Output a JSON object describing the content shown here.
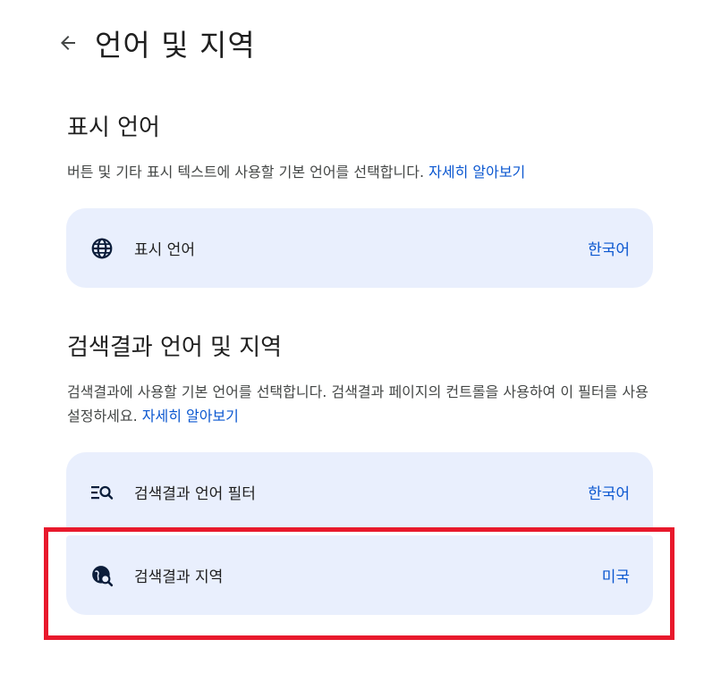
{
  "header": {
    "title": "언어 및 지역",
    "back_icon": "arrow-back-icon"
  },
  "display_language": {
    "title": "표시 언어",
    "description": "버튼 및 기타 표시 텍스트에 사용할 기본 언어를 선택합니다. ",
    "learn_more": "자세히 알아보기",
    "row": {
      "icon": "globe-icon",
      "label": "표시 언어",
      "value": "한국어"
    }
  },
  "search_results": {
    "title": "검색결과 언어 및 지역",
    "description": "검색결과에 사용할 기본 언어를 선택합니다. 검색결과 페이지의 컨트롤을 사용하여 이 필터를 사용 설정하세요. ",
    "learn_more": "자세히 알아보기",
    "rows": [
      {
        "icon": "language-filter-icon",
        "label": "검색결과 언어 필터",
        "value": "한국어"
      },
      {
        "icon": "globe-search-icon",
        "label": "검색결과 지역",
        "value": "미국"
      }
    ]
  },
  "colors": {
    "card_background": "#e9effd",
    "link": "#0b57d0",
    "highlight": "#e8192c"
  }
}
